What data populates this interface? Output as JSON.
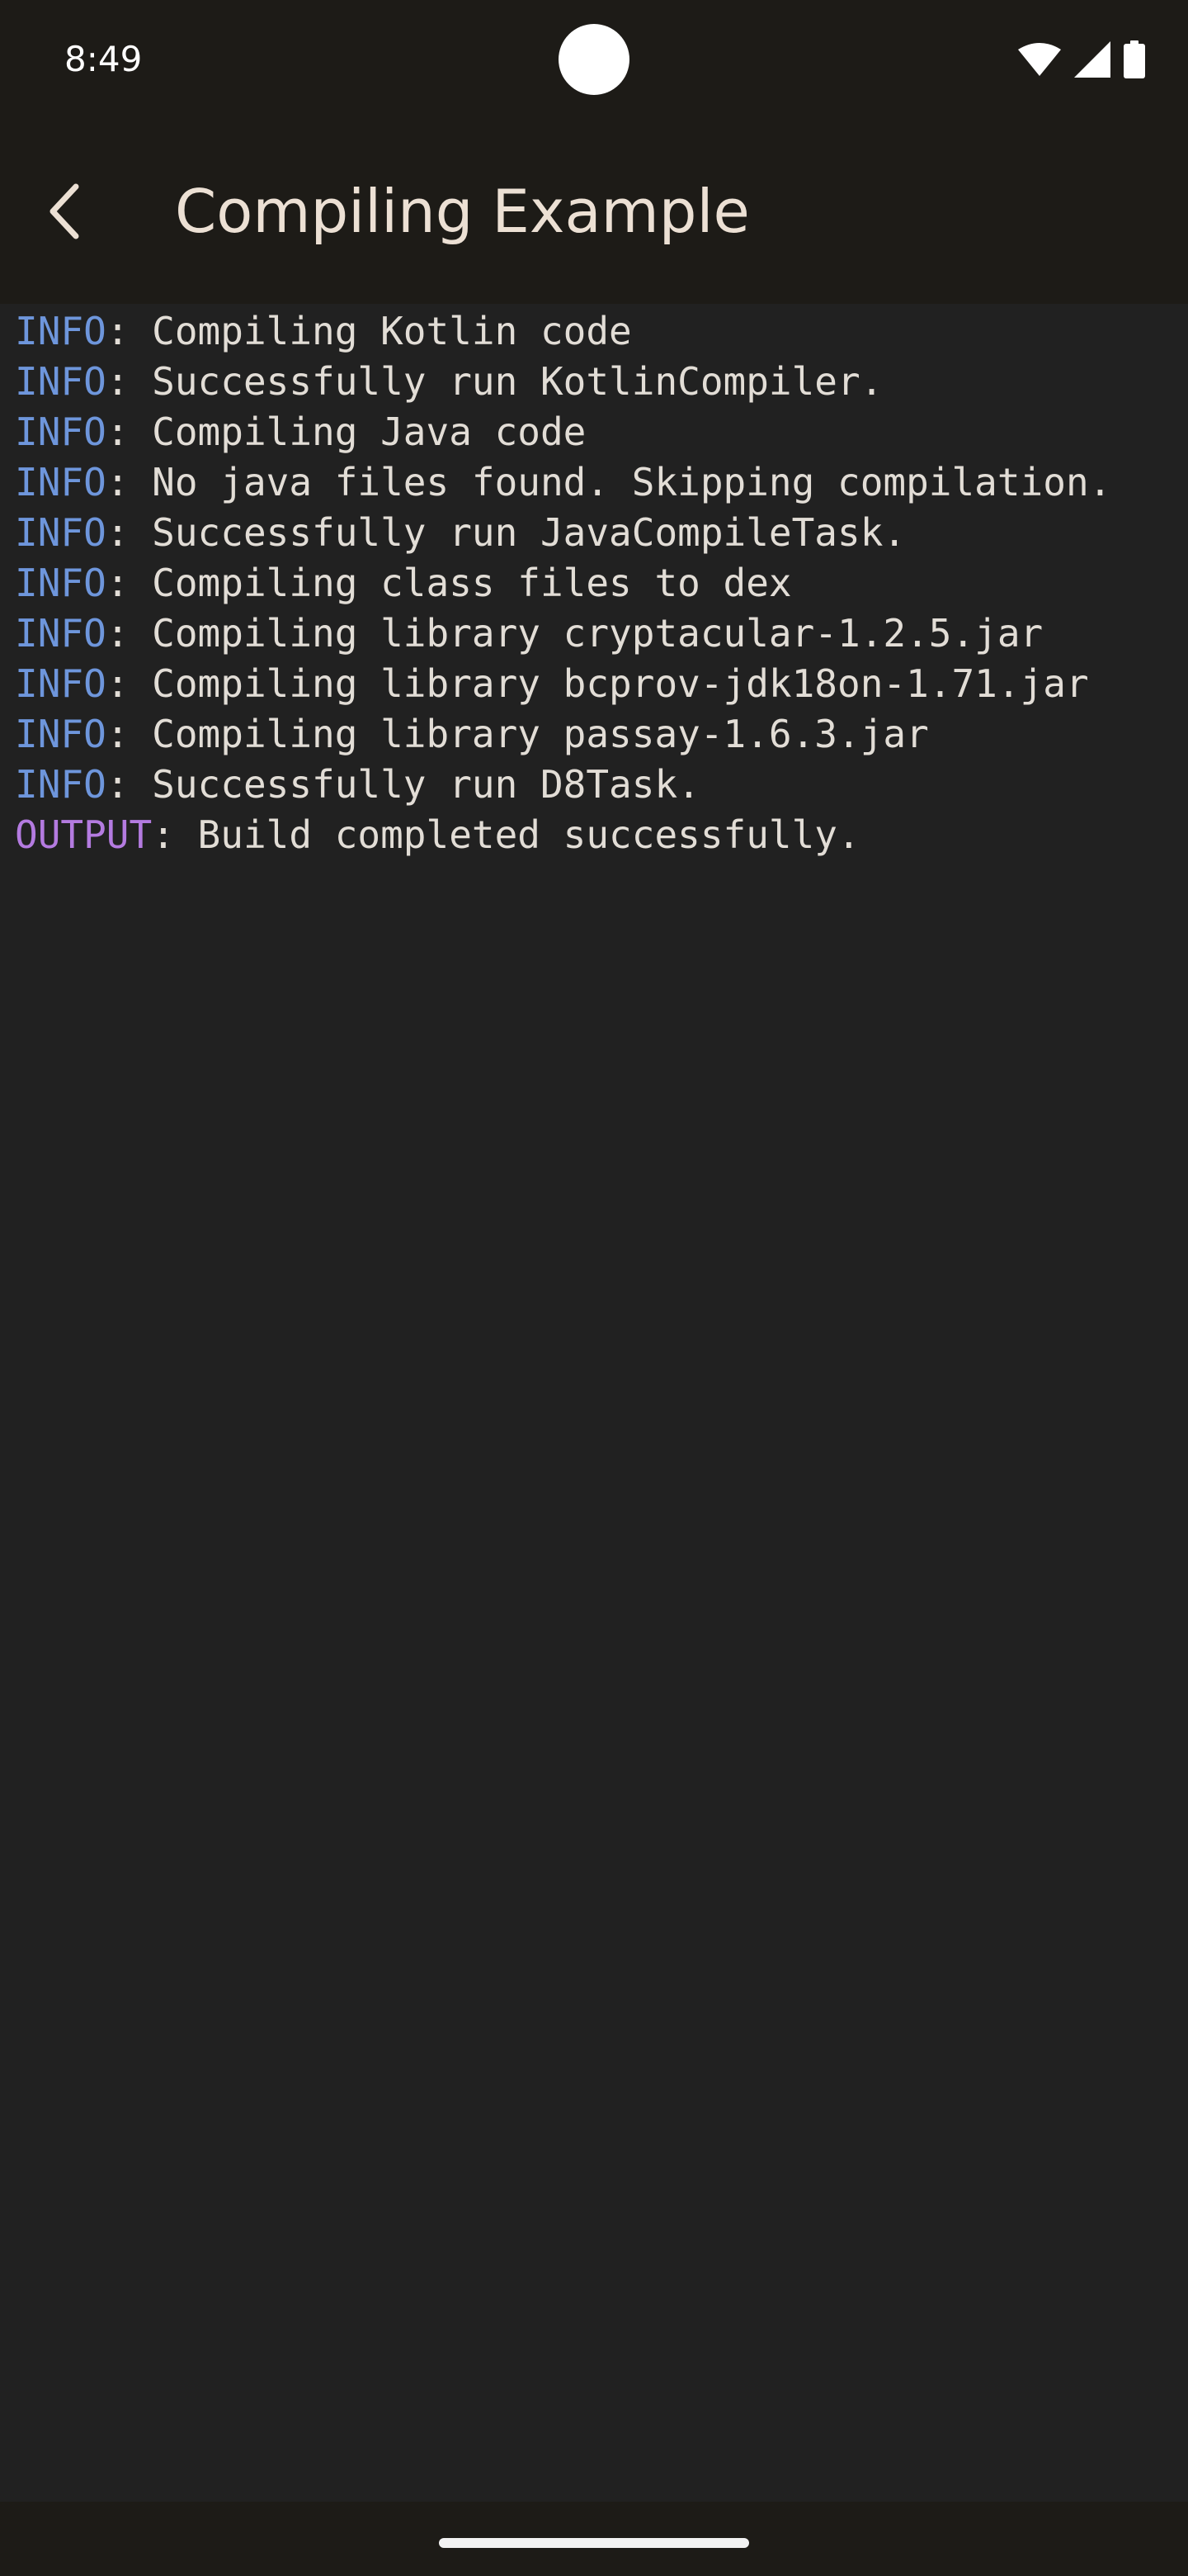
{
  "status_bar": {
    "time": "8:49",
    "icons": [
      "wifi-icon",
      "cellular-signal-icon",
      "battery-icon"
    ]
  },
  "app_bar": {
    "back_icon": "arrow-back-icon",
    "title": "Compiling Example"
  },
  "log": {
    "colors": {
      "info": "#6e96dc",
      "output": "#b47be0",
      "text": "#e2ddd6"
    },
    "lines": [
      {
        "level": "INFO",
        "message": ": Compiling Kotlin code"
      },
      {
        "level": "INFO",
        "message": ": Successfully run KotlinCompiler."
      },
      {
        "level": "INFO",
        "message": ": Compiling Java code"
      },
      {
        "level": "INFO",
        "message": ": No java files found. Skipping compilation."
      },
      {
        "level": "INFO",
        "message": ": Successfully run JavaCompileTask."
      },
      {
        "level": "INFO",
        "message": ": Compiling class files to dex"
      },
      {
        "level": "INFO",
        "message": ": Compiling library cryptacular-1.2.5.jar"
      },
      {
        "level": "INFO",
        "message": ": Compiling library bcprov-jdk18on-1.71.jar"
      },
      {
        "level": "INFO",
        "message": ": Compiling library passay-1.6.3.jar"
      },
      {
        "level": "INFO",
        "message": ": Successfully run D8Task."
      },
      {
        "level": "OUTPUT",
        "message": ": Build completed successfully."
      }
    ]
  }
}
